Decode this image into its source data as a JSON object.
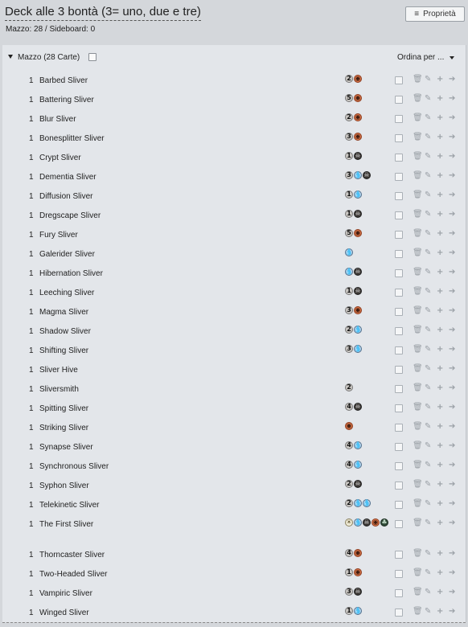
{
  "deck": {
    "title": "Deck alle 3 bontà (3= uno, due e tre)",
    "counts": "Mazzo: 28 / Sideboard: 0",
    "properties_label": "Proprietà"
  },
  "section": {
    "label": "Mazzo (28 Carte)",
    "sort_label": "Ordina per ..."
  },
  "icons": {
    "sliders": "≡",
    "trash": "🗑",
    "edit": "✎",
    "plus": "+",
    "arrow": "➔"
  },
  "colors": {
    "background": "#d4d7db",
    "panel": "#e3e6ea",
    "mana_black": "#3a3633",
    "mana_red": "#e07a4b",
    "mana_blue": "#b6d3ea",
    "mana_green": "#2f4a37",
    "mana_generic": "#c9c6c2"
  },
  "cards": [
    {
      "qty": "1",
      "name": "Barbed Sliver",
      "mana": [
        "2",
        "R"
      ]
    },
    {
      "qty": "1",
      "name": "Battering Sliver",
      "mana": [
        "5",
        "R"
      ]
    },
    {
      "qty": "1",
      "name": "Blur Sliver",
      "mana": [
        "2",
        "R"
      ]
    },
    {
      "qty": "1",
      "name": "Bonesplitter Sliver",
      "mana": [
        "3",
        "R"
      ]
    },
    {
      "qty": "1",
      "name": "Crypt Sliver",
      "mana": [
        "1",
        "B"
      ]
    },
    {
      "qty": "1",
      "name": "Dementia Sliver",
      "mana": [
        "3",
        "U",
        "B"
      ]
    },
    {
      "qty": "1",
      "name": "Diffusion Sliver",
      "mana": [
        "1",
        "U"
      ]
    },
    {
      "qty": "1",
      "name": "Dregscape Sliver",
      "mana": [
        "1",
        "B"
      ]
    },
    {
      "qty": "1",
      "name": "Fury Sliver",
      "mana": [
        "5",
        "R"
      ]
    },
    {
      "qty": "1",
      "name": "Galerider Sliver",
      "mana": [
        "U"
      ]
    },
    {
      "qty": "1",
      "name": "Hibernation Sliver",
      "mana": [
        "U",
        "B"
      ]
    },
    {
      "qty": "1",
      "name": "Leeching Sliver",
      "mana": [
        "1",
        "B"
      ]
    },
    {
      "qty": "1",
      "name": "Magma Sliver",
      "mana": [
        "3",
        "R"
      ]
    },
    {
      "qty": "1",
      "name": "Shadow Sliver",
      "mana": [
        "2",
        "U"
      ]
    },
    {
      "qty": "1",
      "name": "Shifting Sliver",
      "mana": [
        "3",
        "U"
      ]
    },
    {
      "qty": "1",
      "name": "Sliver Hive",
      "mana": []
    },
    {
      "qty": "1",
      "name": "Sliversmith",
      "mana": [
        "2"
      ]
    },
    {
      "qty": "1",
      "name": "Spitting Sliver",
      "mana": [
        "4",
        "B"
      ]
    },
    {
      "qty": "1",
      "name": "Striking Sliver",
      "mana": [
        "R"
      ]
    },
    {
      "qty": "1",
      "name": "Synapse Sliver",
      "mana": [
        "4",
        "U"
      ]
    },
    {
      "qty": "1",
      "name": "Synchronous Sliver",
      "mana": [
        "4",
        "U"
      ]
    },
    {
      "qty": "1",
      "name": "Syphon Sliver",
      "mana": [
        "2",
        "B"
      ]
    },
    {
      "qty": "1",
      "name": "Telekinetic Sliver",
      "mana": [
        "2",
        "U",
        "U"
      ]
    },
    {
      "qty": "1",
      "name": "The First Sliver",
      "mana": [
        "W",
        "U",
        "B",
        "R",
        "G"
      ]
    },
    {
      "qty": "1",
      "name": "Thorncaster Sliver",
      "mana": [
        "4",
        "R"
      ]
    },
    {
      "qty": "1",
      "name": "Two-Headed Sliver",
      "mana": [
        "1",
        "R"
      ]
    },
    {
      "qty": "1",
      "name": "Vampiric Sliver",
      "mana": [
        "3",
        "B"
      ]
    },
    {
      "qty": "1",
      "name": "Winged Sliver",
      "mana": [
        "1",
        "U"
      ]
    }
  ]
}
